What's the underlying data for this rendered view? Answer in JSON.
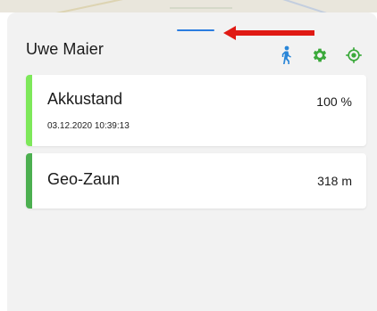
{
  "header": {
    "title": "Uwe Maier",
    "icons": [
      "walking-person-icon",
      "gear-icon",
      "locate-icon"
    ]
  },
  "cards": {
    "battery": {
      "title": "Akkustand",
      "value": "100 %",
      "timestamp": "03.12.2020 10:39:13",
      "accent": "#7ee85a"
    },
    "geofence": {
      "title": "Geo-Zaun",
      "value": "318 m",
      "accent": "#4caf50"
    }
  },
  "colors": {
    "handle": "#2b7de0",
    "walk_icon": "#2a86d8",
    "green_icon": "#3aa93a",
    "arrow": "#e01a14",
    "sheet_bg": "#f2f2f2"
  }
}
